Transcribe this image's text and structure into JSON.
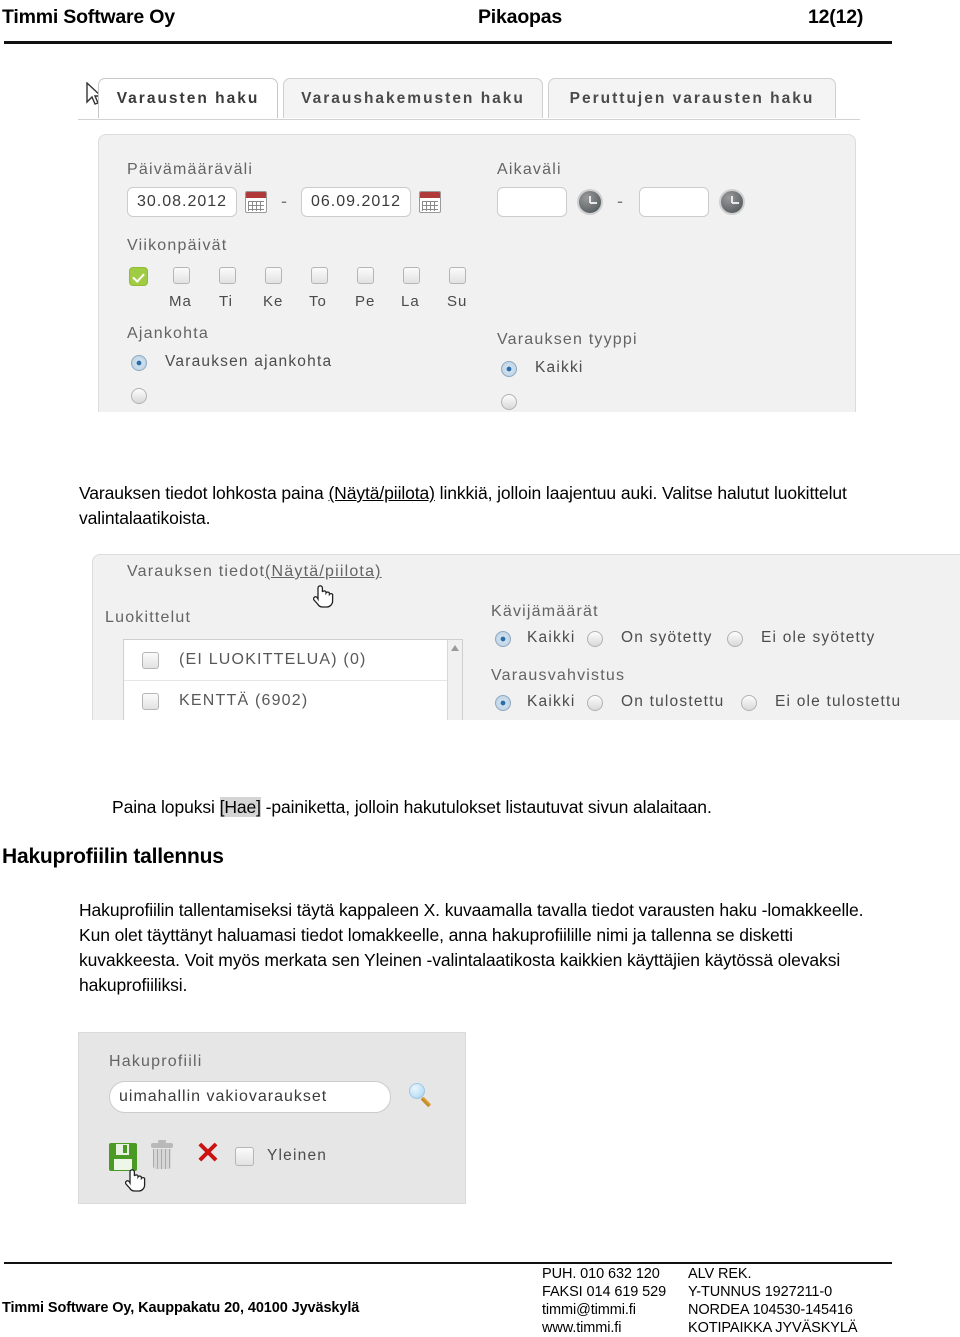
{
  "header": {
    "left": "Timmi Software Oy",
    "center": "Pikaopas",
    "right": "12(12)"
  },
  "screenshot_reservation_search": {
    "tabs": [
      {
        "label": "Varausten haku",
        "active": true
      },
      {
        "label": "Varaushakemusten haku",
        "active": false
      },
      {
        "label": "Peruttujen varausten haku",
        "active": false
      }
    ],
    "date_range": {
      "label": "Päivämääräväli",
      "from": "30.08.2012",
      "to": "06.09.2012",
      "separator": "-",
      "calendar_icon": "calendar-icon"
    },
    "time_range": {
      "label": "Aikaväli",
      "from": "",
      "to": "",
      "separator": "-",
      "clock_icon": "clock-icon"
    },
    "weekdays": {
      "label": "Viikonpäivät",
      "select_all_checked": true,
      "days": [
        "Ma",
        "Ti",
        "Ke",
        "To",
        "Pe",
        "La",
        "Su"
      ]
    },
    "timing": {
      "label": "Ajankohta",
      "options": [
        {
          "label": "Varauksen ajankohta",
          "selected": true
        }
      ]
    },
    "reservation_type": {
      "label": "Varauksen tyyppi",
      "options": [
        {
          "label": "Kaikki",
          "selected": true
        }
      ]
    },
    "cursor": "arrow-cursor"
  },
  "paragraph_1": {
    "part_a": "Varauksen tiedot lohkosta paina ",
    "link": "(Näytä/piilota)",
    "part_b": " linkkiä, jolloin laajentuu auki. Valitse halutut luokittelut valintalaatikoista."
  },
  "screenshot_reservation_details": {
    "title": "Varauksen tiedot",
    "toggle_link": "(Näytä/piilota)",
    "cursor": "hand-cursor",
    "classifications": {
      "label": "Luokittelut",
      "items": [
        {
          "label": "(EI LUOKITTELUA) (0)",
          "checked": false
        },
        {
          "label": "KENTTÄ (6902)",
          "checked": false
        }
      ],
      "scrollbar": "vertical-scrollbar"
    },
    "visitor_counts": {
      "label": "Kävijämäärät",
      "options": [
        {
          "label": "Kaikki",
          "selected": true
        },
        {
          "label": "On syötetty",
          "selected": false
        },
        {
          "label": "Ei ole syötetty",
          "selected": false
        }
      ]
    },
    "reservation_confirmation": {
      "label": "Varausvahvistus",
      "options": [
        {
          "label": "Kaikki",
          "selected": true
        },
        {
          "label": "On tulostettu",
          "selected": false
        },
        {
          "label": "Ei ole tulostettu",
          "selected": false
        }
      ]
    }
  },
  "paragraph_2": {
    "part_a": "Paina lopuksi ",
    "button": "[Hae]",
    "part_b": " -painiketta, jolloin hakutulokset listautuvat sivun alalaitaan."
  },
  "section_title": "Hakuprofiilin tallennus",
  "paragraph_3": "Hakuprofiilin tallentamiseksi täytä kappaleen X. kuvaamalla tavalla tiedot varausten haku -lomakkeelle. Kun olet täyttänyt haluamasi tiedot lomakkeelle, anna hakuprofiilille nimi ja tallenna se disketti kuvakkeesta. Voit myös merkata sen Yleinen -valintalaatikosta kaikkien käyttäjien käytössä olevaksi hakuprofiiliksi.",
  "screenshot_search_profile": {
    "label": "Hakuprofiili",
    "name_value": "uimahallin vakiovaraukset",
    "search_icon": "magnifier-icon",
    "save_icon": "floppy-disk-save-icon",
    "delete_icon": "trash-can-icon",
    "cancel_icon": "red-x-icon",
    "public_checkbox": {
      "label": "Yleinen",
      "checked": false
    },
    "cursor": "hand-cursor"
  },
  "footer": {
    "company_address": "Timmi Software Oy, Kauppakatu 20, 40100 Jyväskylä",
    "contact": {
      "phone": "PUH. 010 632 120",
      "fax": "FAKSI 014 619 529",
      "email": "timmi@timmi.fi",
      "web": "www.timmi.fi"
    },
    "registry": {
      "line1": "ALV REK.",
      "line2": "Y-TUNNUS 1927211-0",
      "line3": "NORDEA 104530-145416",
      "line4": "KOTIPAIKKA JYVÄSKYLÄ"
    }
  }
}
